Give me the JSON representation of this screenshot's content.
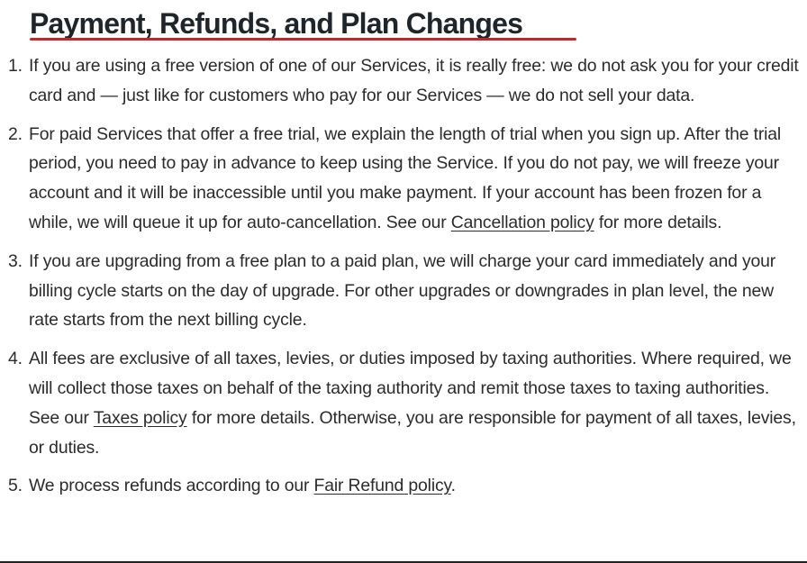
{
  "heading": {
    "title": "Payment, Refunds, and Plan Changes",
    "underline_color": "#c0282d"
  },
  "items": [
    {
      "number": "1.",
      "text": "If you are using a free version of one of our Services, it is really free: we do not ask you for your credit card and — just like for customers who pay for our Services — we do not sell your data."
    },
    {
      "number": "2.",
      "text_before": "For paid Services that offer a free trial, we explain the length of trial when you sign up. After the trial period, you need to pay in advance to keep using the Service. If you do not pay, we will freeze your account and it will be inaccessible until you make payment. If your account has been frozen for a while, we will queue it up for auto-cancellation. See our ",
      "link": "Cancellation policy",
      "text_after": " for more details."
    },
    {
      "number": "3.",
      "text": "If you are upgrading from a free plan to a paid plan, we will charge your card immediately and your billing cycle starts on the day of upgrade. For other upgrades or downgrades in plan level, the new rate starts from the next billing cycle."
    },
    {
      "number": "4.",
      "text_before": "All fees are exclusive of all taxes, levies, or duties imposed by taxing authorities. Where required, we will collect those taxes on behalf of the taxing authority and remit those taxes to taxing authorities. See our ",
      "link": "Taxes policy",
      "text_after": " for more details. Otherwise, you are responsible for payment of all taxes, levies, or duties."
    },
    {
      "number": "5.",
      "text_before": "We process refunds according to our ",
      "link": "Fair Refund policy",
      "text_after": "."
    }
  ]
}
